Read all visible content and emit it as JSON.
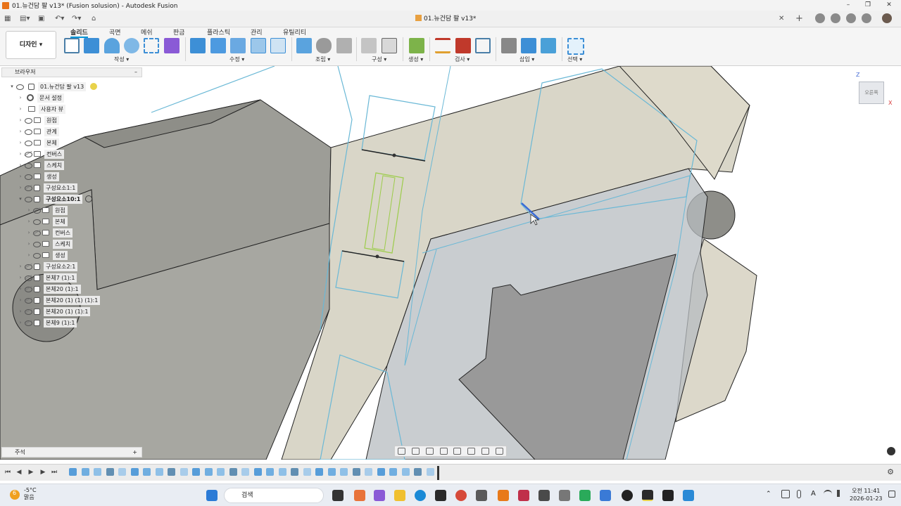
{
  "window": {
    "title": "01.뉴건담 팔 v13* (Fusion solusion) - Autodesk Fusion",
    "minimize": "–",
    "maximize": "❐",
    "close": "✕"
  },
  "document_tab": {
    "name": "01.뉴건담 팔 v13*",
    "close": "✕",
    "new_tab": "+"
  },
  "ribbon": {
    "workspace": "디자인 ▾",
    "tabs": [
      "솔리드",
      "곡면",
      "메쉬",
      "판금",
      "플라스틱",
      "관리",
      "유틸리티"
    ],
    "active_tab": "솔리드",
    "groups": [
      "작성 ▾",
      "수정 ▾",
      "조립 ▾",
      "구성 ▾",
      "검사 ▾",
      "삽입 ▾",
      "선택 ▾",
      "생성 ▾"
    ]
  },
  "browser": {
    "header": "브라우저",
    "collapse": "–",
    "root": "01.뉴건담 팔 v13",
    "items": [
      {
        "label": "문서 설정"
      },
      {
        "label": "사용자 뷰"
      },
      {
        "label": "원점"
      },
      {
        "label": "관계"
      },
      {
        "label": "본체"
      },
      {
        "label": "컨버스"
      },
      {
        "label": "스케치"
      },
      {
        "label": "생성"
      },
      {
        "label": "구성요소1:1"
      },
      {
        "label": "구성요소10:1"
      },
      {
        "label": "원점"
      },
      {
        "label": "본체"
      },
      {
        "label": "컨버스"
      },
      {
        "label": "스케치"
      },
      {
        "label": "생성"
      },
      {
        "label": "구성요소2:1"
      },
      {
        "label": "본체7 (1):1"
      },
      {
        "label": "본체20 (1):1"
      },
      {
        "label": "본체20 (1) (1) (1):1"
      },
      {
        "label": "본체20 (1) (1):1"
      },
      {
        "label": "본체9 (1):1"
      }
    ]
  },
  "viewcube": {
    "face": "오른쪽",
    "axis_z": "Z",
    "axis_x": "X"
  },
  "comments": {
    "label": "주석",
    "add": "+"
  },
  "taskbar": {
    "temperature": "-5°C",
    "weather": "맑음",
    "badge": "6",
    "search_placeholder": "검색",
    "time": "오전 11:41",
    "date": "2026-01-23"
  },
  "colors": {
    "accent": "#0696d7",
    "body_gray": "#a9a9a4",
    "body_beige": "#d9d6c8",
    "sketch_blue": "#6ab8d6",
    "sketch_green": "#9ccc4a"
  }
}
